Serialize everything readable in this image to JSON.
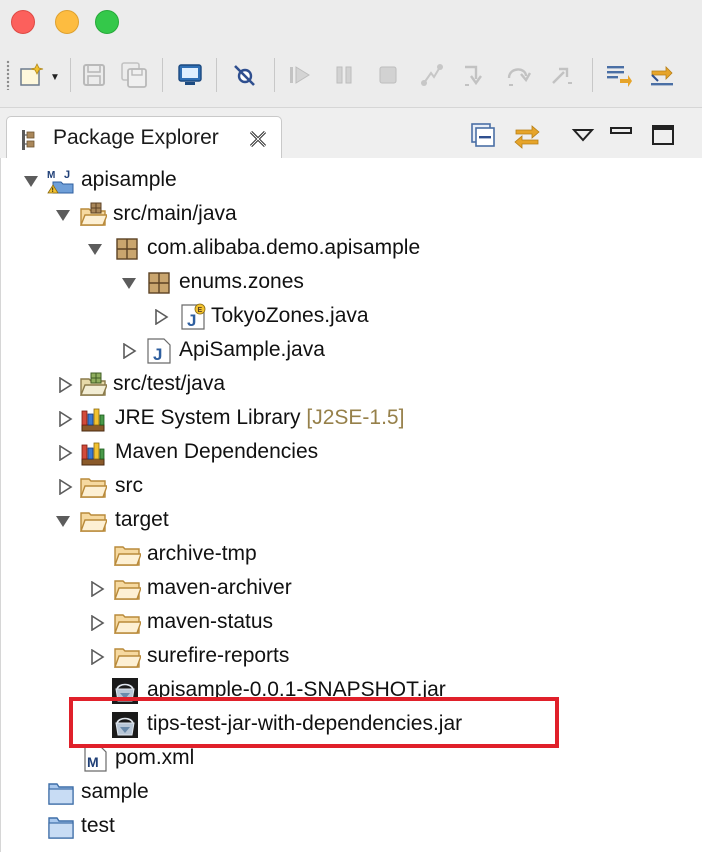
{
  "window": {
    "traffic_lights": [
      "close",
      "minimize",
      "zoom"
    ]
  },
  "toolbar": {
    "buttons": [
      {
        "name": "new-wizard",
        "icon": "new-wizard-icon"
      },
      {
        "name": "save",
        "icon": "save-icon"
      },
      {
        "name": "save-all",
        "icon": "save-all-icon"
      },
      {
        "name": "open-console",
        "icon": "console-icon"
      },
      {
        "name": "skip-breakpoints",
        "icon": "skip-breakpoints-icon"
      },
      {
        "name": "resume",
        "icon": "resume-icon"
      },
      {
        "name": "suspend",
        "icon": "suspend-icon"
      },
      {
        "name": "terminate",
        "icon": "terminate-icon"
      },
      {
        "name": "disconnect",
        "icon": "disconnect-icon"
      },
      {
        "name": "step-into",
        "icon": "step-into-icon"
      },
      {
        "name": "step-over",
        "icon": "step-over-icon"
      },
      {
        "name": "step-return",
        "icon": "step-return-icon"
      },
      {
        "name": "next-annotation",
        "icon": "next-annotation-icon"
      },
      {
        "name": "previous-annotation",
        "icon": "previous-annotation-icon"
      }
    ]
  },
  "view": {
    "tab_title": "Package Explorer",
    "tab_close_icon": "close-icon",
    "actions": [
      "collapse-all-icon",
      "link-with-editor-icon",
      "view-menu-icon",
      "minimize-icon",
      "maximize-icon"
    ]
  },
  "tree": {
    "items": [
      {
        "label": "apisample",
        "icon": "maven-project-icon",
        "expanded": true
      },
      {
        "label": "src/main/java",
        "icon": "source-folder-icon",
        "expanded": true
      },
      {
        "label": "com.alibaba.demo.apisample",
        "icon": "package-icon",
        "expanded": true
      },
      {
        "label": "enums.zones",
        "icon": "package-icon",
        "expanded": true
      },
      {
        "label": "TokyoZones.java",
        "icon": "java-enum-file-icon",
        "expanded": false
      },
      {
        "label": "ApiSample.java",
        "icon": "java-file-icon",
        "expanded": false
      },
      {
        "label": "src/test/java",
        "icon": "source-folder-icon",
        "expanded": false
      },
      {
        "label": "JRE System Library",
        "decoration": "[J2SE-1.5]",
        "icon": "library-icon",
        "expanded": false
      },
      {
        "label": "Maven Dependencies",
        "icon": "library-icon",
        "expanded": false
      },
      {
        "label": "src",
        "icon": "folder-icon",
        "expanded": false
      },
      {
        "label": "target",
        "icon": "folder-icon",
        "expanded": true
      },
      {
        "label": "archive-tmp",
        "icon": "folder-icon"
      },
      {
        "label": "maven-archiver",
        "icon": "folder-icon",
        "expanded": false
      },
      {
        "label": "maven-status",
        "icon": "folder-icon",
        "expanded": false
      },
      {
        "label": "surefire-reports",
        "icon": "folder-icon",
        "expanded": false
      },
      {
        "label": "apisample-0.0.1-SNAPSHOT.jar",
        "icon": "jar-file-icon"
      },
      {
        "label": "tips-test-jar-with-dependencies.jar",
        "icon": "jar-file-icon",
        "highlighted": true
      },
      {
        "label": "pom.xml",
        "icon": "maven-pom-icon"
      },
      {
        "label": "sample",
        "icon": "closed-project-icon"
      },
      {
        "label": "test",
        "icon": "closed-project-icon"
      }
    ]
  },
  "colors": {
    "highlight_border": "#e0202a",
    "decoration_text": "#96804a",
    "folder": "#e8b45a"
  }
}
